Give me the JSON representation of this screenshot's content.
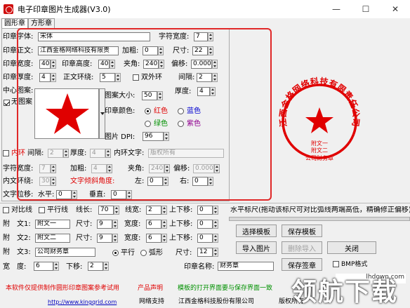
{
  "window": {
    "title": "电子印章图片生成器(V3.0)"
  },
  "tabs": [
    {
      "label": "圆形章"
    },
    {
      "label": "方形章"
    }
  ],
  "form": {
    "font_label": "印章字体:",
    "font_value": "宋体",
    "char_width_label": "字符宽度:",
    "char_width_value": "7",
    "main_text_label": "印章正文:",
    "main_text_value": "江西金格网络科技有限责",
    "bold_label": "加粗:",
    "bold_value": "0",
    "size_label": "尺寸:",
    "size_value": "22",
    "width_label": "印章宽度:",
    "width_value": "40",
    "height_label": "印章高度:",
    "height_value": "40",
    "angle_label": "夹角:",
    "angle_value": "240",
    "offset_label": "偏移:",
    "offset_value": "0.000",
    "thickness_label": "印章厚度:",
    "thickness_value": "4",
    "ring_label": "正文环绕:",
    "ring_value": "5",
    "double_ring_label": "双外环",
    "gap_label": "间隔:",
    "gap_value": "2",
    "center_label": "中心图案:",
    "no_pattern_label": "无图案",
    "pattern_size_label": "图案大小:",
    "pattern_size_value": "50",
    "pattern_thickness_label": "厚度:",
    "pattern_thickness_value": "4",
    "color_label": "印章颜色:",
    "colors": [
      {
        "label": "红色",
        "hex": "#e00000"
      },
      {
        "label": "蓝色",
        "hex": "#0000d0"
      },
      {
        "label": "绿色",
        "hex": "#009000"
      },
      {
        "label": "紫色",
        "hex": "#900090"
      }
    ],
    "dpi_label": "图片 DPI:",
    "dpi_value": "96",
    "inner_ring_label": "内环",
    "inner_gap_label": "间隔:",
    "inner_gap_value": "2",
    "inner_thick_label": "厚度:",
    "inner_thick_value": "4",
    "inner_text_label": "内环文字:",
    "inner_text_value": "版权所有",
    "char_w2_label": "字符宽度:",
    "char_w2_value": "7",
    "bold2_label": "加粗:",
    "bold2_value": "4",
    "angle2_label": "夹角:",
    "angle2_value": "240",
    "offset2_label": "偏移:",
    "offset2_value": "0.000",
    "inner_ring2_label": "内文环绕:",
    "inner_ring2_value": "30",
    "tilt_label": "文字倾斜角度:",
    "left_label": "左:",
    "left_value": "0",
    "right_label": "右:",
    "right_value": "0",
    "text_shift_label": "文字位移:",
    "horiz_label": "水平:",
    "horiz_value": "0",
    "vert_label": "垂直:",
    "vert_value": "0"
  },
  "seal": {
    "main_text": "江西金格网络科技有限责任公司",
    "sub1": "附文一",
    "sub2": "附文二",
    "sub3": "公司财务章",
    "color": "#e00000"
  },
  "lines": {
    "contrast_label": "对比线",
    "parallel_label": "平行线",
    "linewidth_label": "线长:",
    "linewidth_value": "70",
    "linewidth2_label": "线宽:",
    "linewidth2_value": "2",
    "shift_label": "上下移:",
    "shift_value": "0",
    "ruler_text": "水平标尺(拖动该标尺可对比弧线两端高低，精确修正偏移)"
  },
  "sub": [
    {
      "label": "附　文1:",
      "value": "附文一",
      "size_label": "尺寸:",
      "size_value": "9",
      "width_label": "宽度:",
      "width_value": "6",
      "shift_label": "上下移:",
      "shift_value": "0"
    },
    {
      "label": "附　文2:",
      "value": "附文二",
      "size_label": "尺寸:",
      "size_value": "9",
      "width_label": "宽度:",
      "width_value": "6",
      "shift_label": "上下移:",
      "shift_value": "0"
    },
    {
      "label": "附　文3:",
      "value": "公司财务章"
    }
  ],
  "sub3": {
    "parallel_label": "平行",
    "arc_label": "弧形",
    "size_label": "尺寸:",
    "size_value": "12"
  },
  "width_row": {
    "label": "宽　度:",
    "value": "6",
    "shift_label": "下移:",
    "shift_value": "2"
  },
  "seal_name_label": "印章名称:",
  "seal_name_value": "财务章",
  "bmp_label": "BMP格式",
  "buttons": {
    "select": "选择模板",
    "save_tpl": "保存模板",
    "import": "导入图片",
    "delete_import": "删除导入",
    "close": "关闭",
    "save_seal": "保存签章"
  },
  "footer": {
    "notice": "本软件仅提供制作圆形印章图案参考试用",
    "product": "产品声明",
    "notice2": "模板的打开界面要与保存界面一致",
    "url": "http://www.kingqrid.com",
    "support": "网络支持",
    "company": "江西金格科技股份有限公司",
    "rights": "版权所有"
  },
  "watermark": {
    "main": "领航下载",
    "site": "lhdown.com"
  }
}
